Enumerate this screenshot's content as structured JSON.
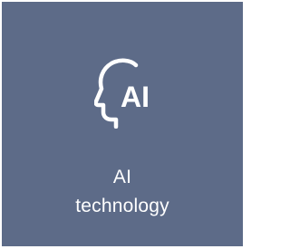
{
  "tile": {
    "label_line1": "AI",
    "label_line2": "technology",
    "icon": "ai-head-icon",
    "icon_text": "AI",
    "background": "#5d6b88",
    "foreground": "#ffffff"
  }
}
